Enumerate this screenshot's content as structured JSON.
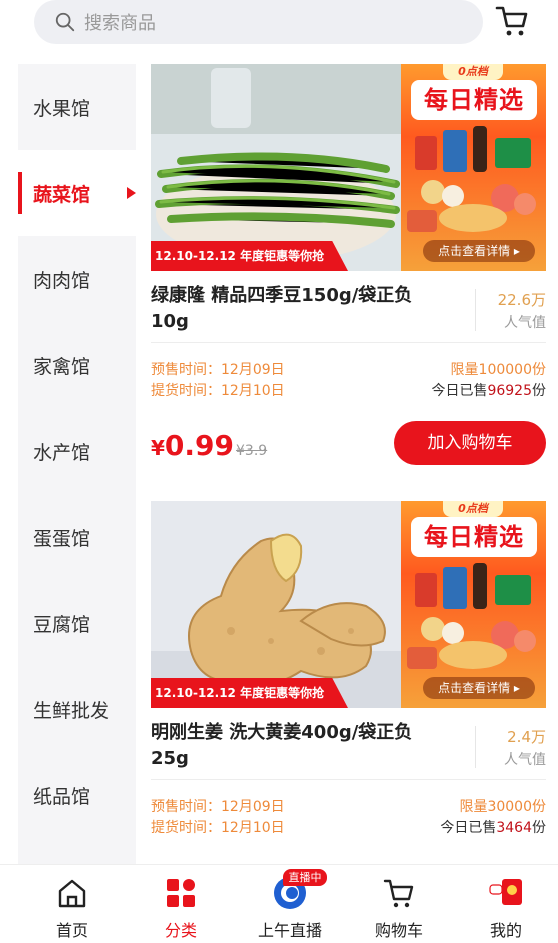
{
  "search": {
    "placeholder": "搜索商品"
  },
  "sidebar": {
    "items": [
      {
        "label": "水果馆",
        "active": false
      },
      {
        "label": "蔬菜馆",
        "active": true
      },
      {
        "label": "肉肉馆",
        "active": false
      },
      {
        "label": "家禽馆",
        "active": false
      },
      {
        "label": "水产馆",
        "active": false
      },
      {
        "label": "蛋蛋馆",
        "active": false
      },
      {
        "label": "豆腐馆",
        "active": false
      },
      {
        "label": "生鲜批发",
        "active": false
      },
      {
        "label": "纸品馆",
        "active": false
      }
    ]
  },
  "promo": {
    "tag": "0点档",
    "title": "每日精选",
    "detail_button": "点击查看详情 ▸",
    "ribbon": "12.10-12.12 年度钜惠等你抢"
  },
  "products": [
    {
      "name": "绿康隆 精品四季豆150g/袋正负10g",
      "popularity_value": "22.6万",
      "popularity_label": "人气值",
      "presale": "预售时间：12月09日",
      "pickup": "提货时间：12月10日",
      "limit": "限量100000份",
      "sold_prefix": "今日已售",
      "sold_count": "96925",
      "sold_suffix": "份",
      "currency": "¥",
      "price": "0.99",
      "original_price": "¥3.9",
      "add_to_cart": "加入购物车"
    },
    {
      "name": "明刚生姜 洗大黄姜400g/袋正负25g",
      "popularity_value": "2.4万",
      "popularity_label": "人气值",
      "presale": "预售时间：12月09日",
      "pickup": "提货时间：12月10日",
      "limit": "限量30000份",
      "sold_prefix": "今日已售",
      "sold_count": "3464",
      "sold_suffix": "份"
    }
  ],
  "bottom_nav": {
    "items": [
      {
        "label": "首页",
        "icon": "home-icon",
        "active": false
      },
      {
        "label": "分类",
        "icon": "category-icon",
        "active": true
      },
      {
        "label": "上午直播",
        "icon": "live-icon",
        "active": false,
        "badge": "直播中"
      },
      {
        "label": "购物车",
        "icon": "cart-icon",
        "active": false
      },
      {
        "label": "我的",
        "icon": "profile-icon",
        "active": false
      }
    ]
  },
  "colors": {
    "accent": "#e8141c",
    "orange_text": "#ee8a3a",
    "sidebar_bg": "#f5f5f7"
  }
}
